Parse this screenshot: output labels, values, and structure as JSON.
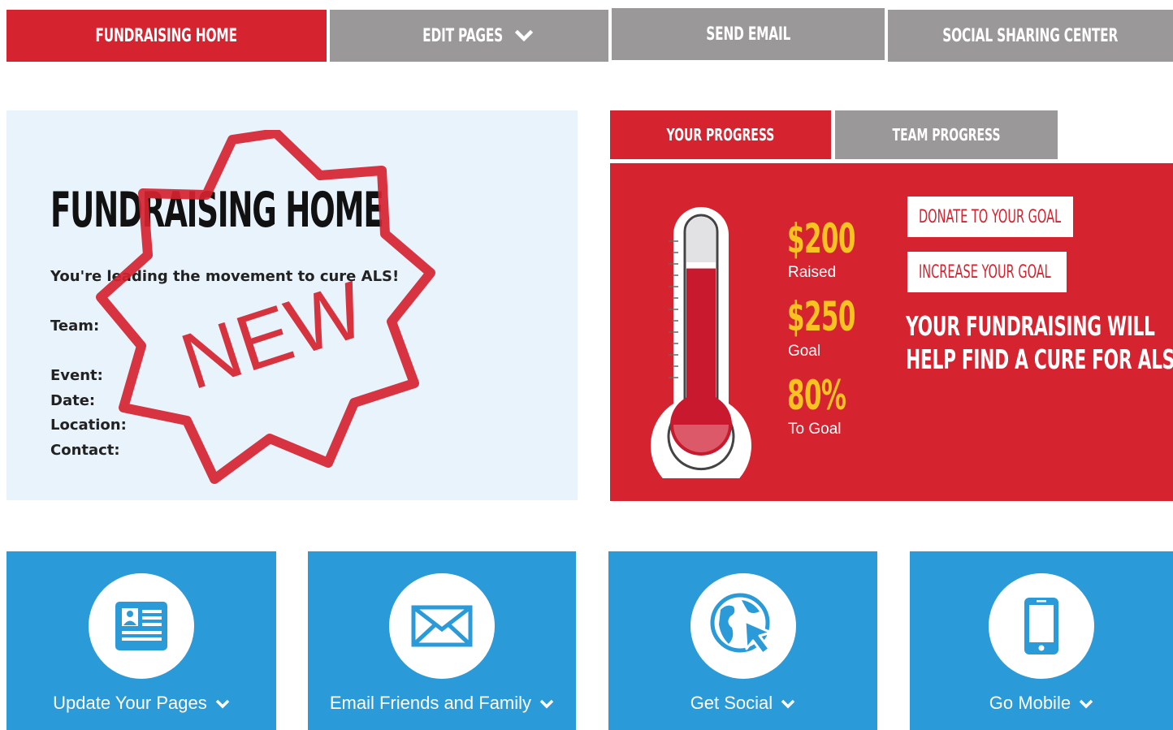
{
  "nav": {
    "tabs": [
      {
        "label": "FUNDRAISING HOME",
        "active": true
      },
      {
        "label": "EDIT PAGES",
        "active": false,
        "has_dropdown": true
      },
      {
        "label": "SEND EMAIL",
        "active": false
      },
      {
        "label": "SOCIAL SHARING CENTER",
        "active": false
      }
    ]
  },
  "info": {
    "title": "FUNDRAISING HOME",
    "tagline": "You're leading the movement to cure ALS!",
    "team_label": "Team:",
    "event_label": "Event:",
    "date_label": "Date:",
    "location_label": "Location:",
    "contact_label": "Contact:",
    "badge_text": "NEW"
  },
  "progress": {
    "tabs": [
      {
        "label": "YOUR PROGRESS",
        "active": true
      },
      {
        "label": "TEAM PROGRESS",
        "active": false
      }
    ],
    "raised_value": "$200",
    "raised_label": "Raised",
    "goal_value": "$250",
    "goal_label": "Goal",
    "percent_value": "80%",
    "percent_label": "To Goal",
    "fill_fraction": 0.8,
    "donate_button": "DONATE TO YOUR GOAL",
    "increase_button": "INCREASE YOUR GOAL",
    "cure_line1": "YOUR FUNDRAISING WILL",
    "cure_line2": "HELP FIND A CURE FOR ALS!"
  },
  "tiles": [
    {
      "label": "Update Your Pages",
      "icon": "profile-card-icon"
    },
    {
      "label": "Email Friends and Family",
      "icon": "envelope-icon"
    },
    {
      "label": "Get Social",
      "icon": "globe-cursor-icon"
    },
    {
      "label": "Go Mobile",
      "icon": "mobile-phone-icon"
    }
  ],
  "colors": {
    "brand_red": "#d52330",
    "inactive_gray": "#9a9899",
    "panel_light_blue": "#e8f3fb",
    "tile_blue": "#2b9ad8",
    "stat_yellow": "#f7c321"
  }
}
